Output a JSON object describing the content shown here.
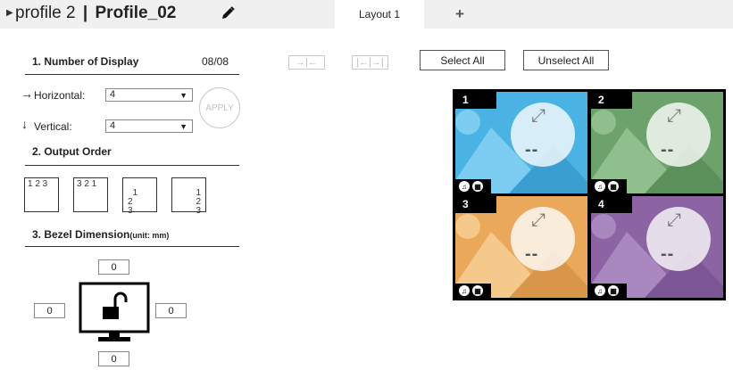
{
  "header": {
    "profile_prefix": "profile 2",
    "separator": "|",
    "profile_title": "Profile_02",
    "tab_label": "Layout 1",
    "add_tab_label": "+"
  },
  "section1": {
    "title": "1.  Number of Display",
    "count": "08/08",
    "horizontal_label": "Horizontal:",
    "horizontal_value": "4",
    "vertical_label": "Vertical:",
    "vertical_value": "4",
    "apply_label": "APPLY"
  },
  "section2": {
    "title": "2.   Output Order",
    "options": [
      "1 2 3",
      "3 2 1",
      "1\n2\n3",
      "1\n2\n3"
    ]
  },
  "section3": {
    "title": "3.  Bezel Dimension",
    "unit": "(unit: mm)",
    "top": "0",
    "left": "0",
    "right": "0",
    "bottom": "0"
  },
  "toolbar": {
    "select_all": "Select All",
    "unselect_all": "Unselect All",
    "merge_icon_glyph": "→|←",
    "split_icon_glyph": "|←|→|"
  },
  "preview": {
    "cells": [
      {
        "number": "1",
        "placeholder": "--",
        "color": "#4ab3e3",
        "hill": "#7ccdf1",
        "dark": "#3a9fd0"
      },
      {
        "number": "2",
        "placeholder": "--",
        "color": "#6da26c",
        "hill": "#8fbf8d",
        "dark": "#5c905b"
      },
      {
        "number": "3",
        "placeholder": "--",
        "color": "#e9a85a",
        "hill": "#f5c98c",
        "dark": "#d9954a"
      },
      {
        "number": "4",
        "placeholder": "--",
        "color": "#8c64a3",
        "hill": "#a988bf",
        "dark": "#7c5694"
      }
    ]
  },
  "colors": {
    "header_bg": "#f0f0f0",
    "tab_bg": "#ffffff",
    "preview_border": "#000000"
  }
}
